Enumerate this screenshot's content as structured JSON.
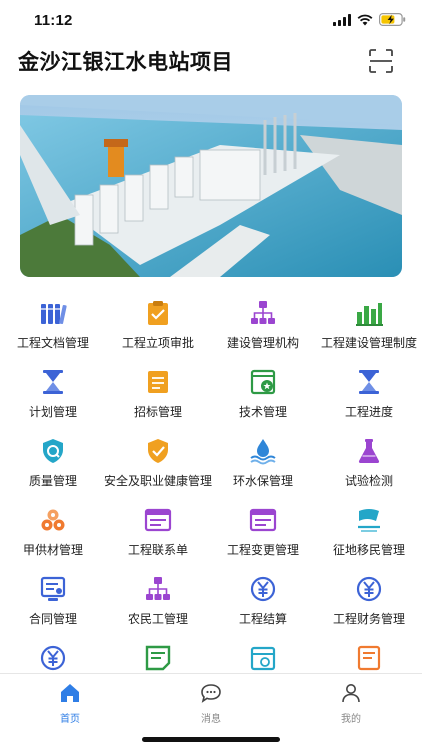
{
  "status": {
    "time": "11:12"
  },
  "header": {
    "title": "金沙江银江水电站项目",
    "scan_icon": "scan-icon"
  },
  "banner": {
    "image": "hydropower-station-photo"
  },
  "grid": [
    {
      "label": "工程文档管理",
      "icon": "books-icon",
      "color": "#3c63d6"
    },
    {
      "label": "工程立项审批",
      "icon": "clipboard-check-icon",
      "color": "#f0a020"
    },
    {
      "label": "建设管理机构",
      "icon": "org-chart-icon",
      "color": "#9b45d0"
    },
    {
      "label": "工程建设管理制度",
      "icon": "bar-chart-icon",
      "color": "#3aa845"
    },
    {
      "label": "计划管理",
      "icon": "hourglass-icon",
      "color": "#3c63d6"
    },
    {
      "label": "招标管理",
      "icon": "document-icon",
      "color": "#f0a020"
    },
    {
      "label": "技术管理",
      "icon": "star-window-icon",
      "color": "#2e9a45"
    },
    {
      "label": "工程进度",
      "icon": "hourglass-icon",
      "color": "#3c63d6"
    },
    {
      "label": "质量管理",
      "icon": "shield-check-icon",
      "color": "#24a6c8"
    },
    {
      "label": "安全及职业健康管理",
      "icon": "shield-check-icon",
      "color": "#f0a020"
    },
    {
      "label": "环水保管理",
      "icon": "water-icon",
      "color": "#2f86d8"
    },
    {
      "label": "试验检测",
      "icon": "flask-icon",
      "color": "#9b45d0"
    },
    {
      "label": "甲供材管理",
      "icon": "materials-icon",
      "color": "#f07a30"
    },
    {
      "label": "工程联系单",
      "icon": "form-icon",
      "color": "#9b45d0"
    },
    {
      "label": "工程变更管理",
      "icon": "form-icon",
      "color": "#9b45d0"
    },
    {
      "label": "征地移民管理",
      "icon": "flag-icon",
      "color": "#24a6c8"
    },
    {
      "label": "合同管理",
      "icon": "contract-icon",
      "color": "#3c63d6"
    },
    {
      "label": "农民工管理",
      "icon": "org-chart-icon",
      "color": "#9b45d0"
    },
    {
      "label": "工程结算",
      "icon": "yen-icon",
      "color": "#3c63d6"
    },
    {
      "label": "工程财务管理",
      "icon": "yen-icon",
      "color": "#3c63d6"
    },
    {
      "label": "",
      "icon": "yen-icon",
      "color": "#3c63d6"
    },
    {
      "label": "",
      "icon": "note-icon",
      "color": "#2e9a45"
    },
    {
      "label": "",
      "icon": "calendar-icon",
      "color": "#24a6c8"
    },
    {
      "label": "",
      "icon": "checklist-icon",
      "color": "#f07a30"
    }
  ],
  "tabs": [
    {
      "label": "首页",
      "icon": "home-icon",
      "active": true
    },
    {
      "label": "消息",
      "icon": "message-icon",
      "active": false
    },
    {
      "label": "我的",
      "icon": "user-icon",
      "active": false
    }
  ],
  "colors": {
    "accent": "#2f7ee6",
    "text": "#111111"
  }
}
